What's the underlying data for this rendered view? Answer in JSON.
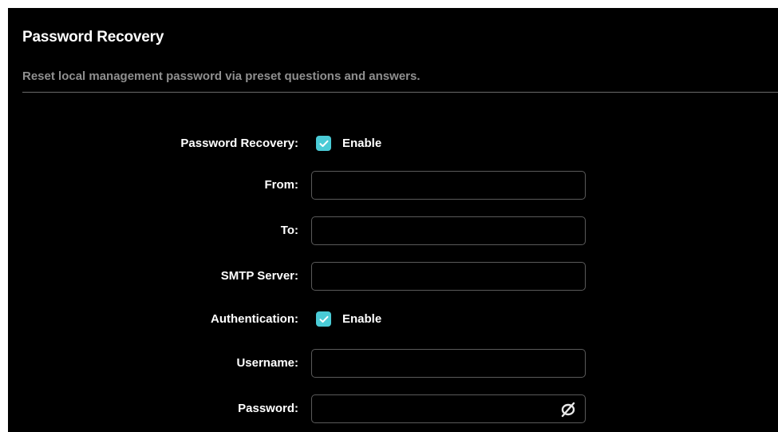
{
  "header": {
    "title": "Password Recovery",
    "subtitle": "Reset local management password via preset questions and answers."
  },
  "form": {
    "password_recovery": {
      "label": "Password Recovery:",
      "checkbox_label": "Enable",
      "checked": true
    },
    "from": {
      "label": "From:",
      "value": ""
    },
    "to": {
      "label": "To:",
      "value": ""
    },
    "smtp_server": {
      "label": "SMTP Server:",
      "value": ""
    },
    "authentication": {
      "label": "Authentication:",
      "checkbox_label": "Enable",
      "checked": true
    },
    "username": {
      "label": "Username:",
      "value": ""
    },
    "password": {
      "label": "Password:",
      "value": "",
      "toggle_icon": "eye-slash-icon"
    }
  },
  "colors": {
    "background": "#000000",
    "accent": "#4acbd6",
    "subtitle": "#8f8f8f",
    "border": "#5a5a5a"
  }
}
